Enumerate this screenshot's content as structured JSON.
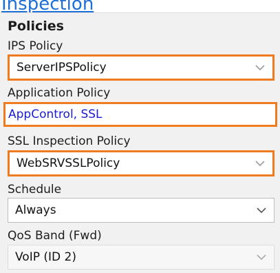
{
  "top_link": {
    "text": "Inspection"
  },
  "policies": {
    "title": "Policies",
    "ips_policy": {
      "label": "IPS Policy",
      "value": "ServerIPSPolicy"
    },
    "application_policy": {
      "label": "Application Policy",
      "value": "AppControl, SSL"
    },
    "ssl_inspection_policy": {
      "label": "SSL Inspection Policy",
      "value": "WebSRVSSLPolicy"
    },
    "schedule": {
      "label": "Schedule",
      "value": "Always"
    },
    "qos_band": {
      "label": "QoS Band (Fwd)",
      "value": "VoIP (ID 2)"
    }
  },
  "colors": {
    "highlight": "#f07a1e",
    "link": "#1e6fd8",
    "panel_bg": "#f1f1f1"
  },
  "icons": {
    "dropdown": "chevron-down-icon"
  }
}
